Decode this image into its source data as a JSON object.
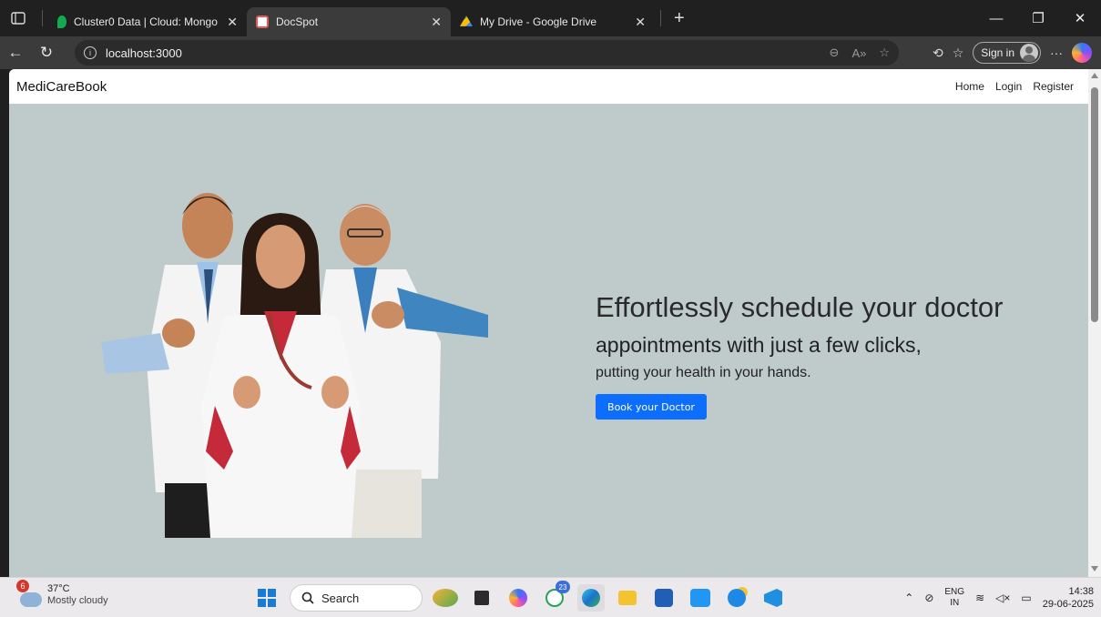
{
  "browser": {
    "tabs": [
      {
        "title": "Cluster0 Data | Cloud: MongoDB Cloud",
        "active": false,
        "favicon": "mongodb-leaf-icon",
        "color": "#13aa52"
      },
      {
        "title": "DocSpot",
        "active": true,
        "favicon": "docspot-icon",
        "color": "#e25a5a"
      },
      {
        "title": "My Drive - Google Drive",
        "active": false,
        "favicon": "google-drive-icon",
        "color": "#fbbc04"
      }
    ],
    "address": "localhost:3000",
    "sign_in": "Sign in"
  },
  "site": {
    "brand": "MediCareBook",
    "nav": [
      "Home",
      "Login",
      "Register"
    ],
    "hero": {
      "line1": "Effortlessly schedule your doctor",
      "line2": "appointments with just a few clicks,",
      "line3": "putting your health in your hands.",
      "cta": "Book your Doctor"
    },
    "background": "#bfcbcb",
    "accent": "#0d6efd"
  },
  "taskbar": {
    "weather": {
      "badge": "6",
      "temp": "37°C",
      "condition": "Mostly cloudy"
    },
    "search": "Search",
    "whatsapp_badge": "23",
    "lang": {
      "line1": "ENG",
      "line2": "IN"
    },
    "time": "14:38",
    "date": "29-06-2025"
  }
}
